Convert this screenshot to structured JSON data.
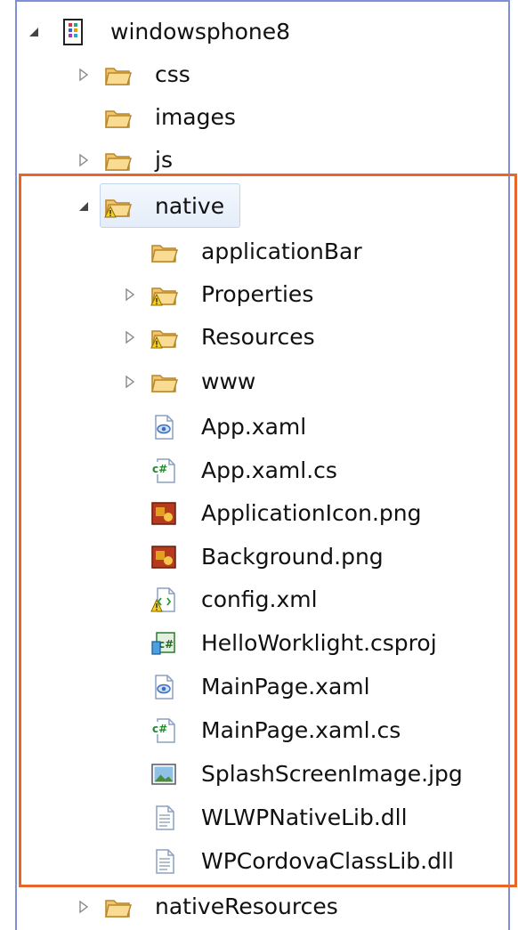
{
  "colors": {
    "accent_border": "#e8662a",
    "frame_border": "#7f8fd8",
    "folder": "#f2c46b"
  },
  "tree": {
    "root": {
      "label": "windowsphone8",
      "icon": "project-icon",
      "expanded": true
    },
    "items": [
      {
        "label": "css",
        "icon": "folder-icon",
        "expander": "collapsed"
      },
      {
        "label": "images",
        "icon": "folder-icon",
        "expander": "none"
      },
      {
        "label": "js",
        "icon": "folder-icon",
        "expander": "collapsed"
      },
      {
        "label": "native",
        "icon": "folder-warning-icon",
        "expander": "expanded",
        "selected": true
      },
      {
        "label": "applicationBar",
        "icon": "folder-icon",
        "expander": "none"
      },
      {
        "label": "Properties",
        "icon": "folder-warning-icon",
        "expander": "collapsed"
      },
      {
        "label": "Resources",
        "icon": "folder-warning-icon",
        "expander": "collapsed"
      },
      {
        "label": "www",
        "icon": "folder-icon",
        "expander": "collapsed"
      },
      {
        "label": "App.xaml",
        "icon": "xaml-file-icon",
        "expander": "none"
      },
      {
        "label": "App.xaml.cs",
        "icon": "csharp-file-icon",
        "expander": "none"
      },
      {
        "label": "ApplicationIcon.png",
        "icon": "png-image-icon",
        "expander": "none"
      },
      {
        "label": "Background.png",
        "icon": "png-image-icon",
        "expander": "none"
      },
      {
        "label": "config.xml",
        "icon": "xml-warning-icon",
        "expander": "none"
      },
      {
        "label": "HelloWorklight.csproj",
        "icon": "csproj-icon",
        "expander": "none"
      },
      {
        "label": "MainPage.xaml",
        "icon": "xaml-file-icon",
        "expander": "none"
      },
      {
        "label": "MainPage.xaml.cs",
        "icon": "csharp-file-icon",
        "expander": "none"
      },
      {
        "label": "SplashScreenImage.jpg",
        "icon": "jpg-image-icon",
        "expander": "none"
      },
      {
        "label": "WLWPNativeLib.dll",
        "icon": "dll-file-icon",
        "expander": "none"
      },
      {
        "label": "WPCordovaClassLib.dll",
        "icon": "dll-file-icon",
        "expander": "none"
      },
      {
        "label": "nativeResources",
        "icon": "folder-icon",
        "expander": "collapsed"
      }
    ]
  }
}
